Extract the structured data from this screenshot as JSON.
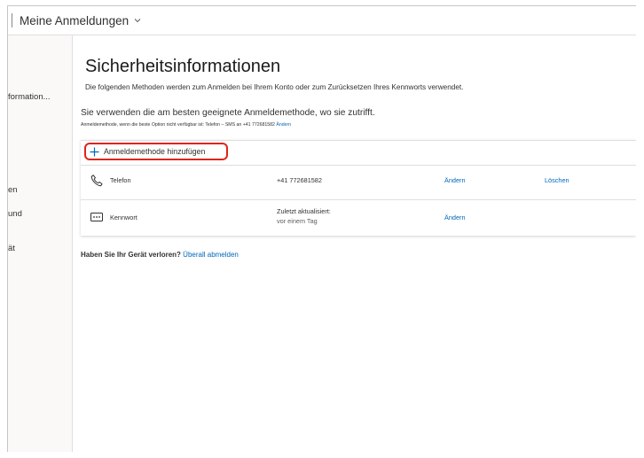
{
  "topbar": {
    "app_title": "Meine Anmeldungen"
  },
  "sidebar": {
    "items": [
      {
        "label": "formation...",
        "active": true
      },
      {
        "label": "en"
      },
      {
        "label": "und"
      },
      {
        "label": "ät"
      }
    ]
  },
  "main": {
    "title": "Sicherheitsinformationen",
    "subtitle": "Die folgenden Methoden werden zum Anmelden bei Ihrem Konto oder zum Zurücksetzen Ihres Kennworts verwendet.",
    "default_method": {
      "heading": "Sie verwenden die am besten geeignete Anmeldemethode, wo sie zutrifft.",
      "note": "Anmeldemethode, wenn die beste Option nicht verfügbar ist: Telefon – SMS an +41 772681582",
      "note_link": "Ändern"
    },
    "add_method_label": "Anmeldemethode hinzufügen",
    "methods": [
      {
        "icon": "phone-icon",
        "name": "Telefon",
        "detail": "+41 772681582",
        "change": "Ändern",
        "delete": "Löschen"
      },
      {
        "icon": "password-icon",
        "name": "Kennwort",
        "detail": "Zuletzt aktualisiert:",
        "detail_sub": "vor einem Tag",
        "change": "Ändern"
      }
    ],
    "lost_device": {
      "question": "Haben Sie Ihr Gerät verloren?",
      "link": "Überall abmelden"
    }
  },
  "colors": {
    "accent_link": "#0067b8",
    "highlight": "#e0241b"
  }
}
